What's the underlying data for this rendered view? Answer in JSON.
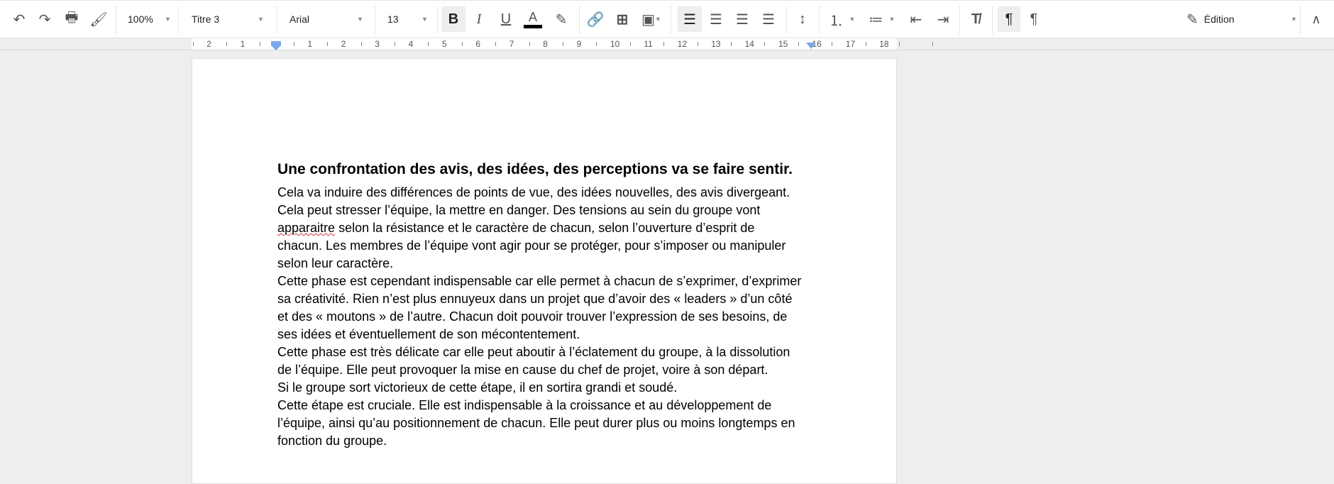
{
  "toolbar": {
    "zoom": "100%",
    "style": "Titre 3",
    "font": "Arial",
    "size": "13",
    "mode": "Édition",
    "text_color": "#000000",
    "icons": [
      "undo-icon",
      "redo-icon",
      "print-icon",
      "paint-format-icon",
      "bold-icon",
      "italic-icon",
      "underline-icon",
      "text-color-icon",
      "highlight-icon",
      "link-icon",
      "add-comment-icon",
      "image-icon",
      "align-left-icon",
      "align-center-icon",
      "align-right-icon",
      "justify-icon",
      "line-spacing-icon",
      "numbered-list-icon",
      "bulleted-list-icon",
      "decrease-indent-icon",
      "increase-indent-icon",
      "clear-formatting-icon",
      "ltr-icon",
      "rtl-icon",
      "pencil-icon",
      "collapse-icon"
    ]
  },
  "ruler": {
    "labels": [
      "2",
      "1",
      "1",
      "2",
      "3",
      "4",
      "5",
      "6",
      "7",
      "8",
      "9",
      "10",
      "11",
      "12",
      "13",
      "14",
      "15",
      "16",
      "17",
      "18"
    ]
  },
  "document": {
    "heading": "Une confrontation des avis, des idées, des perceptions va se faire sentir.",
    "misspelled": "apparaitre",
    "lines": [
      "Cela va induire des différences de points de vue, des idées nouvelles, des avis divergeant.",
      "Cela peut stresser l’équipe, la mettre en danger. Des tensions au sein du groupe vont",
      " selon la résistance et le caractère de chacun, selon l’ouverture d’esprit de",
      "chacun. Les membres de l’équipe vont agir pour se protéger, pour s’imposer ou manipuler",
      "selon leur caractère.",
      "Cette phase est cependant indispensable car elle permet à chacun de s’exprimer, d’exprimer",
      "sa créativité. Rien n’est plus ennuyeux dans un projet que d’avoir des « leaders » d’un côté",
      "et des « moutons » de l’autre. Chacun doit pouvoir trouver l’expression de ses besoins, de",
      "ses idées et éventuellement de son mécontentement.",
      "Cette phase est très délicate car elle peut aboutir à l’éclatement du groupe, à la dissolution",
      "de l’équipe. Elle peut provoquer la mise en cause du chef de projet, voire à son départ.",
      "Si le groupe sort victorieux de cette étape, il en sortira grandi et soudé.",
      "Cette étape est cruciale. Elle est indispensable à la croissance et au développement de",
      "l’équipe, ainsi qu’au positionnement de chacun. Elle peut durer plus ou moins longtemps en",
      "fonction du groupe."
    ]
  }
}
